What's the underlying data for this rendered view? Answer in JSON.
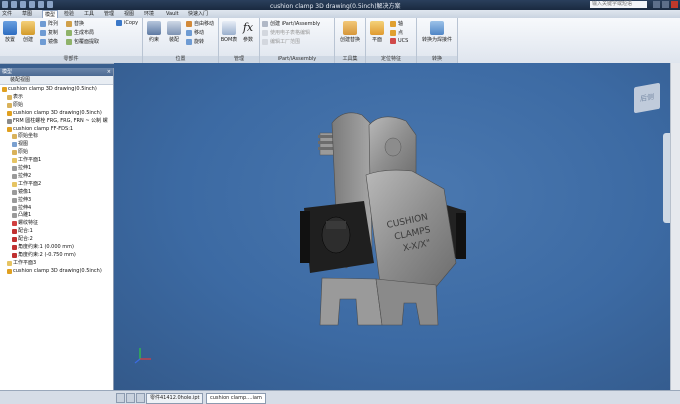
{
  "app": {
    "window_title": "cushion clamp 3D drawing(0.5inch)解决方案",
    "search_placeholder": "输入关键字或短语"
  },
  "menu": [
    {
      "label": "文件"
    },
    {
      "label": "草图"
    },
    {
      "label": "模型"
    },
    {
      "label": "检验"
    },
    {
      "label": "工具"
    },
    {
      "label": "管理"
    },
    {
      "label": "视图"
    },
    {
      "label": "环境"
    },
    {
      "label": "Vault"
    },
    {
      "label": "快速入门"
    }
  ],
  "ribbon": {
    "panels": [
      {
        "label": "零部件"
      },
      {
        "label": "位置"
      },
      {
        "label": "管理"
      },
      {
        "label": "iPart/iAssembly"
      },
      {
        "label": "工具集"
      },
      {
        "label": "定位特征"
      },
      {
        "label": "转换"
      }
    ],
    "components": {
      "place": "放置",
      "create": "创建",
      "array": "阵列",
      "copy": "复制",
      "mirror": "镜像",
      "replace": "替换",
      "gen_layout": "生成布局",
      "shrinkwrap": "包覆面提取",
      "icopy": "iCopy"
    },
    "position": {
      "constrain": "约束",
      "assemble": "装配",
      "free_move": "自由移动",
      "move": "移动",
      "rotate": "旋转"
    },
    "manage": {
      "bom": "BOM表",
      "params": "参数"
    },
    "ipart": {
      "create": "创建 iPart/iAssembly",
      "edit_factory": "使用电子表格编辑",
      "edit_table": "编辑工厂范围"
    },
    "tools": {
      "create_sub": "创建替换"
    },
    "work": {
      "plane": "平面",
      "axis": "轴",
      "point": "点",
      "ucs": "UCS"
    },
    "convert": {
      "to_weldment": "转换为焊接件"
    }
  },
  "browser": {
    "title": "模型",
    "view_mode": "装配视图",
    "nodes": [
      {
        "text": "cushion clamp 3D drawing(0.5inch)",
        "indent": 0,
        "color": "#e0a020"
      },
      {
        "text": "表示",
        "indent": 1,
        "color": "#d9b25a"
      },
      {
        "text": "原始",
        "indent": 1,
        "color": "#d9b25a"
      },
      {
        "text": "cushion clamp 3D drawing(0.5inch)",
        "indent": 1,
        "color": "#e0a020"
      },
      {
        "text": "FRM 圆柱螺栓 FRG, FRG, FRN ~ 公制 螺",
        "indent": 1,
        "color": "#8a8a8a"
      },
      {
        "text": "cushion clamp FF-FDS:1",
        "indent": 1,
        "color": "#e0a020"
      },
      {
        "text": "原始坐标",
        "indent": 2,
        "color": "#d9b25a"
      },
      {
        "text": "视图",
        "indent": 2,
        "color": "#7aa0d0"
      },
      {
        "text": "原始",
        "indent": 2,
        "color": "#d9b25a"
      },
      {
        "text": "工作平面1",
        "indent": 2,
        "color": "#e6c463"
      },
      {
        "text": "拉伸1",
        "indent": 2,
        "color": "#9a9a9a"
      },
      {
        "text": "拉伸2",
        "indent": 2,
        "color": "#9a9a9a"
      },
      {
        "text": "工作平面2",
        "indent": 2,
        "color": "#e6c463"
      },
      {
        "text": "镜像1",
        "indent": 2,
        "color": "#9a9a9a"
      },
      {
        "text": "拉伸3",
        "indent": 2,
        "color": "#9a9a9a"
      },
      {
        "text": "拉伸4",
        "indent": 2,
        "color": "#9a9a9a"
      },
      {
        "text": "凸雕1",
        "indent": 2,
        "color": "#9a9a9a"
      },
      {
        "text": "螺纹特征",
        "indent": 2,
        "color": "#d04040"
      },
      {
        "text": "配合:1",
        "indent": 2,
        "color": "#c03030"
      },
      {
        "text": "配合:2",
        "indent": 2,
        "color": "#c03030"
      },
      {
        "text": "角度约束:1 (0.000 mm)",
        "indent": 2,
        "color": "#c03030"
      },
      {
        "text": "角度约束:2 (-0.750 mm)",
        "indent": 2,
        "color": "#c03030"
      },
      {
        "text": "工作平面3",
        "indent": 1,
        "color": "#e6c463"
      },
      {
        "text": "cushion clamp 3D drawing(0.5inch)",
        "indent": 1,
        "color": "#e0a020"
      }
    ]
  },
  "viewport": {
    "viewcube_label": "后侧",
    "part_text_lines": [
      "CUSHION",
      "CLAMPS",
      "X-X/X\""
    ]
  },
  "tabs": [
    {
      "label": "零件41412.0hole.ipt",
      "active": false
    },
    {
      "label": "cushion clamp....iam",
      "active": true
    }
  ]
}
